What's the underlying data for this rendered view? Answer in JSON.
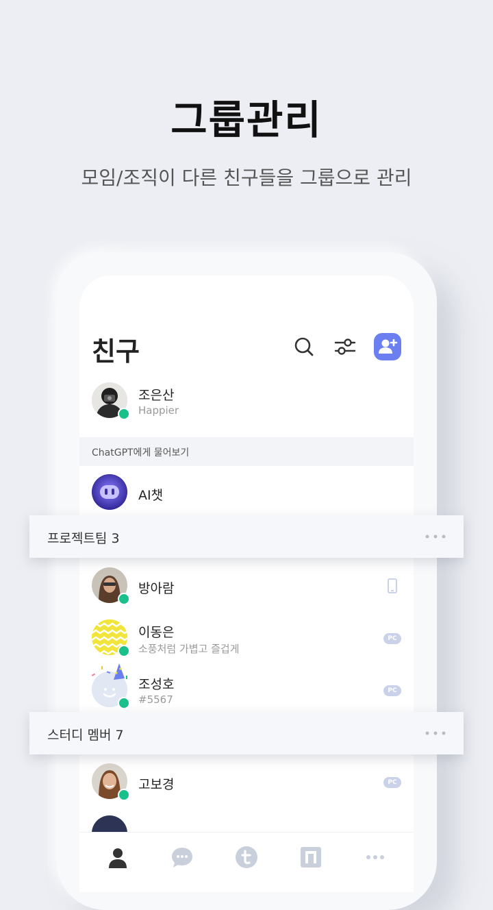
{
  "hero": {
    "title": "그룹관리",
    "subtitle": "모임/조직이 다른 친구들을 그룹으로 관리"
  },
  "header": {
    "title": "친구",
    "icons": [
      "search-icon",
      "filter-icon",
      "add-friend-icon"
    ]
  },
  "profile": {
    "name": "조은산",
    "status": "Happier",
    "online": true
  },
  "section": {
    "label": "ChatGPT에게 물어보기"
  },
  "ai_chat": {
    "name": "AI챗"
  },
  "groups": [
    {
      "label": "프로젝트팀 3",
      "members": [
        {
          "name": "방아람",
          "status": "",
          "device": "mobile",
          "online": true
        },
        {
          "name": "이동은",
          "status": "소풍처럼 가볍고 즐겁게",
          "device": "PC",
          "online": true
        },
        {
          "name": "조성호",
          "status": "#5567",
          "device": "PC",
          "online": true
        }
      ]
    },
    {
      "label": "스터디 멤버 7",
      "members": [
        {
          "name": "고보경",
          "status": "",
          "device": "PC",
          "online": true
        }
      ]
    }
  ],
  "tabbar": {
    "items": [
      "friends-tab-icon",
      "chat-tab-icon",
      "t-tab-icon",
      "n-tab-icon",
      "more-tab-icon"
    ],
    "active": "friends"
  },
  "colors": {
    "accent": "#6b7ff0",
    "online": "#19c08a",
    "background": "#eceef3"
  }
}
